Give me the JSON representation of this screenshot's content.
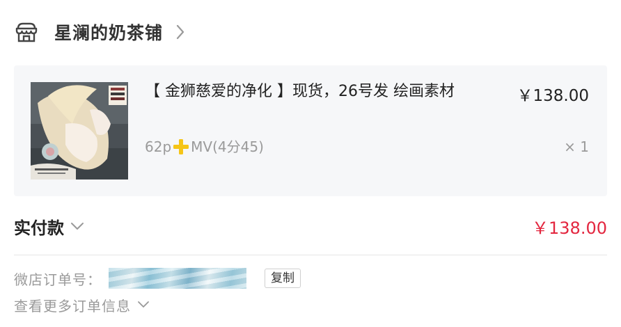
{
  "shop": {
    "name": "星澜的奶茶铺",
    "icon": "shop-icon"
  },
  "product": {
    "title": "【 金狮慈爱的净化 】现货，26号发 绘画素材",
    "spec_prefix": "62p",
    "spec_suffix": "MV(4分45)",
    "price": "￥138.00",
    "quantity": "× 1",
    "thumbnail_icon": "product-thumbnail-image"
  },
  "payment": {
    "label": "实付款",
    "amount": "￥138.00",
    "amount_color": "#e3263f"
  },
  "order": {
    "number_label": "微店订单号：",
    "copy_label": "复制",
    "more_label": "查看更多订单信息"
  },
  "colors": {
    "plus_icon": "#f5c518",
    "card_background": "#f6f7f9",
    "muted_text": "#9a9a9a"
  }
}
